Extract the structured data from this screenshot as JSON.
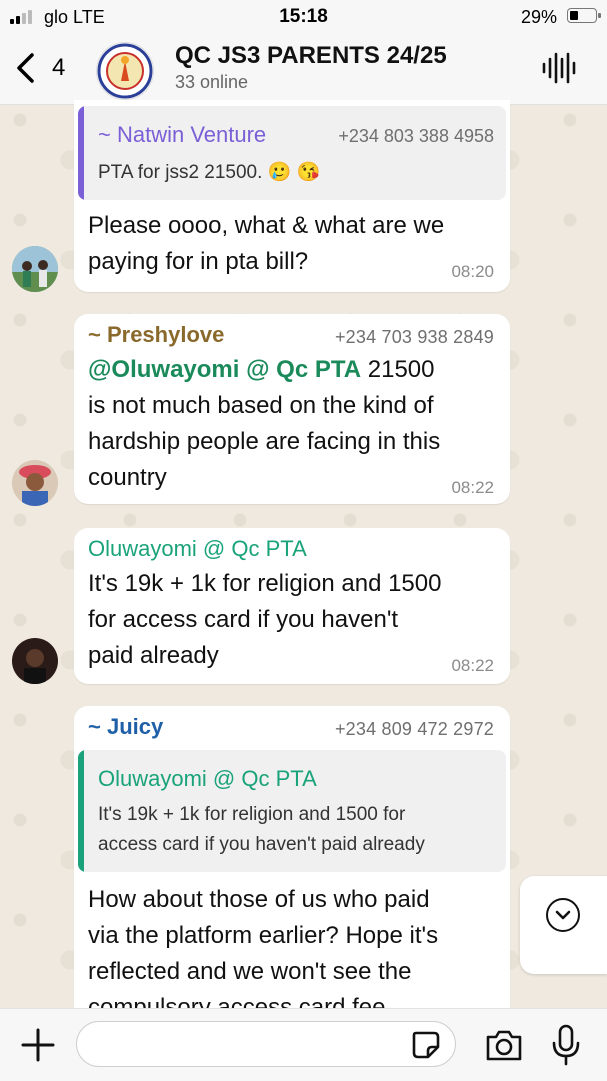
{
  "status_bar": {
    "carrier": "glo  LTE",
    "time": "15:18",
    "battery": "29%"
  },
  "header": {
    "back_count": "4",
    "title": "QC JS3 PARENTS 24/25",
    "subtitle": "33 online"
  },
  "messages": [
    {
      "quote": {
        "sender": "~ Natwin Venture",
        "phone": "+234 803 388 4958",
        "text": "PTA for jss2 21500. 🥲 😘",
        "color": "#7b5fd6"
      },
      "text_lines": [
        "Please oooo, what & what are we",
        "paying for in pta bill?"
      ],
      "time": "08:20"
    },
    {
      "sender": "~ Preshylove",
      "sender_color": "#8a6a2c",
      "phone": "+234 703 938 2849",
      "mention": "@Oluwayomi @ Qc PTA",
      "mention_color": "#1b8a5a",
      "text_first": " 21500",
      "text_lines": [
        "is not much based on the kind of",
        "hardship people are facing in this",
        "country"
      ],
      "time": "08:22"
    },
    {
      "sender": "Oluwayomi @ Qc PTA",
      "sender_color": "#1aa37a",
      "text_lines": [
        "It's 19k + 1k for religion and 1500",
        "for access card if you haven't",
        "paid already"
      ],
      "time": "08:22"
    },
    {
      "sender": "~ Juicy",
      "sender_color": "#1f5fa8",
      "phone": "+234 809 472 2972",
      "quote": {
        "sender": "Oluwayomi @ Qc PTA",
        "text_lines": [
          "It's 19k + 1k for religion and 1500 for",
          "access card if you haven't paid already"
        ],
        "color": "#1aa37a"
      },
      "text_lines": [
        "How about those of us who paid",
        "via the platform earlier? Hope it's",
        "reflected and we won't see the",
        "compulsory access card fee"
      ]
    }
  ],
  "composer": {
    "placeholder": ""
  }
}
